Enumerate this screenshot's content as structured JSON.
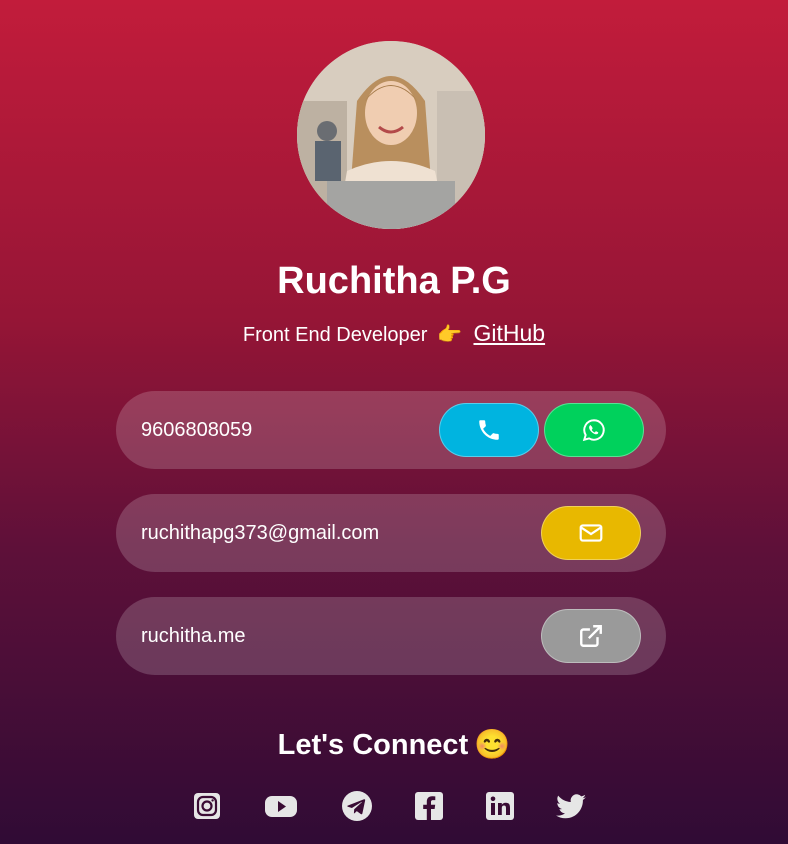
{
  "profile": {
    "name": "Ruchitha P.G",
    "title": "Front End Developer",
    "pointer_emoji": "👉",
    "github_label": "GitHub"
  },
  "contacts": {
    "phone": "9606808059",
    "email": "ruchithapg373@gmail.com",
    "website": "ruchitha.me"
  },
  "connect": {
    "heading": "Let's Connect",
    "emoji": "😊"
  },
  "colors": {
    "call_button": "#00b4e0",
    "whatsapp_button": "#00d15c",
    "email_button": "#e8b800",
    "link_button": "#9a9a9a"
  },
  "icons": [
    "phone-icon",
    "whatsapp-icon",
    "mail-icon",
    "external-link-icon",
    "instagram-icon",
    "youtube-icon",
    "telegram-icon",
    "facebook-icon",
    "linkedin-icon",
    "twitter-icon"
  ]
}
